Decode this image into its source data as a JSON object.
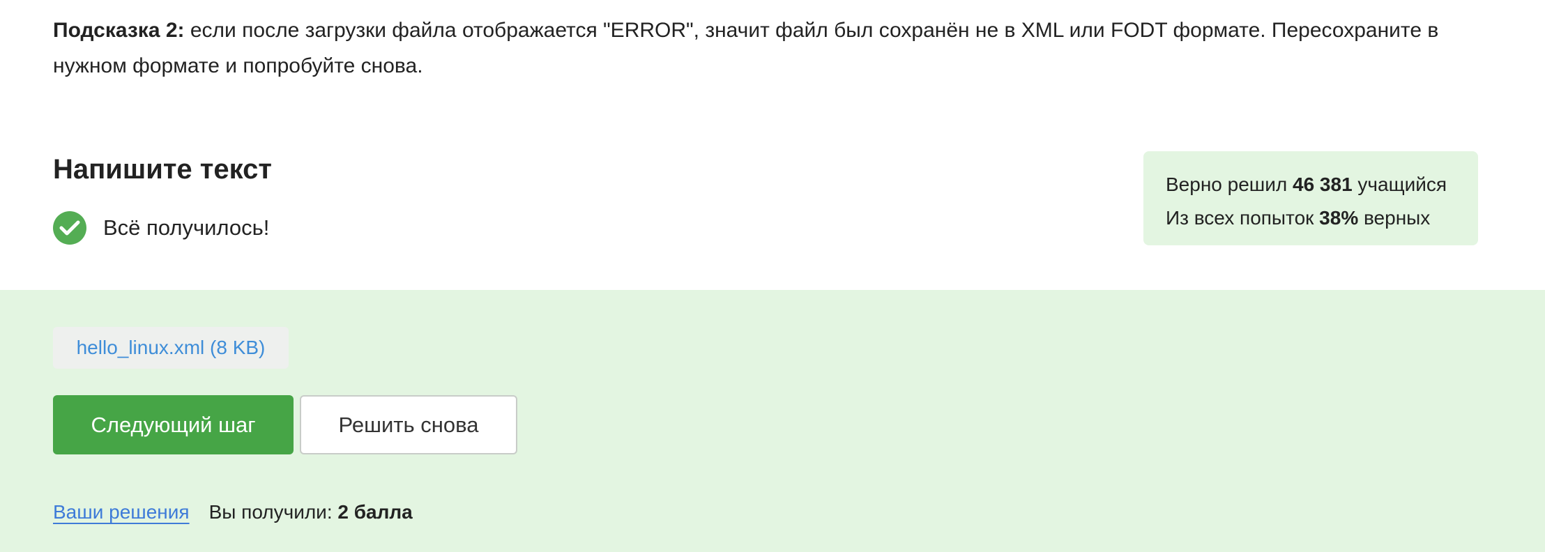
{
  "hint": {
    "label": "Подсказка 2:",
    "text": " если после загрузки файла отображается \"ERROR\", значит файл был сохранён не в XML или FODT формате. Пересохраните в нужном формате и попробуйте снова."
  },
  "task": {
    "title": "Напишите текст",
    "status_text": "Всё получилось!"
  },
  "stats": {
    "solved_prefix": "Верно решил ",
    "solved_count": "46 381",
    "solved_suffix": " учащийся",
    "attempts_prefix": "Из всех попыток ",
    "attempts_percent": "38%",
    "attempts_suffix": " верных"
  },
  "submission": {
    "file_label": "hello_linux.xml (8 KB)",
    "next_button": "Следующий шаг",
    "retry_button": "Решить снова",
    "solutions_link": "Ваши решения",
    "score_prefix": "Вы получили: ",
    "score_value": "2 балла"
  },
  "colors": {
    "accent_green": "#46a546",
    "success_bg": "#e3f5e1",
    "link_blue": "#3e7bd8"
  }
}
